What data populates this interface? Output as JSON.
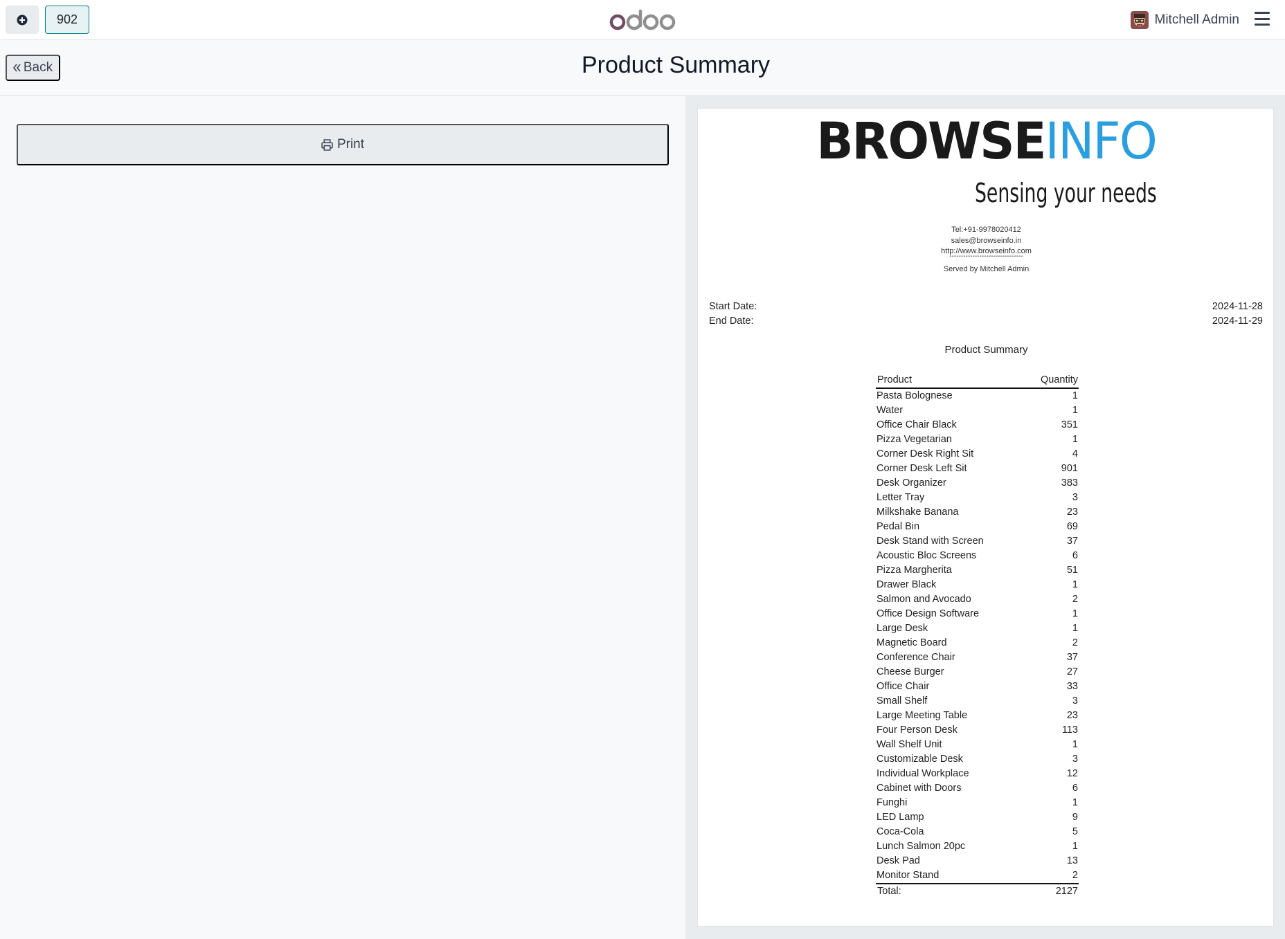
{
  "navbar": {
    "order_number": "902",
    "logo_text": "odoo",
    "user_name": "Mitchell Admin"
  },
  "header": {
    "back_label": "Back",
    "title": "Product Summary"
  },
  "left": {
    "print_label": "Print"
  },
  "receipt": {
    "brand_dark": "BROWSE",
    "brand_blue": "INFO",
    "tagline": "Sensing your needs",
    "tel": "Tel:+91-9978020412",
    "email": "sales@browseinfo.in",
    "website": "http://www.browseinfo.com",
    "dashes": "--------------------------------",
    "served_by": "Served by Mitchell Admin",
    "start_label": "Start Date:",
    "start_value": "2024-11-28",
    "end_label": "End Date:",
    "end_value": "2024-11-29",
    "summary_title": "Product Summary",
    "col_product": "Product",
    "col_quantity": "Quantity",
    "rows": [
      {
        "product": "Pasta Bolognese",
        "qty": "1"
      },
      {
        "product": "Water",
        "qty": "1"
      },
      {
        "product": "Office Chair Black",
        "qty": "351"
      },
      {
        "product": "Pizza Vegetarian",
        "qty": "1"
      },
      {
        "product": "Corner Desk Right Sit",
        "qty": "4"
      },
      {
        "product": "Corner Desk Left Sit",
        "qty": "901"
      },
      {
        "product": "Desk Organizer",
        "qty": "383"
      },
      {
        "product": "Letter Tray",
        "qty": "3"
      },
      {
        "product": "Milkshake Banana",
        "qty": "23"
      },
      {
        "product": "Pedal Bin",
        "qty": "69"
      },
      {
        "product": "Desk Stand with Screen",
        "qty": "37"
      },
      {
        "product": "Acoustic Bloc Screens",
        "qty": "6"
      },
      {
        "product": "Pizza Margherita",
        "qty": "51"
      },
      {
        "product": "Drawer Black",
        "qty": "1"
      },
      {
        "product": "Salmon and Avocado",
        "qty": "2"
      },
      {
        "product": "Office Design Software",
        "qty": "1"
      },
      {
        "product": "Large Desk",
        "qty": "1"
      },
      {
        "product": "Magnetic Board",
        "qty": "2"
      },
      {
        "product": "Conference Chair",
        "qty": "37"
      },
      {
        "product": "Cheese Burger",
        "qty": "27"
      },
      {
        "product": "Office Chair",
        "qty": "33"
      },
      {
        "product": "Small Shelf",
        "qty": "3"
      },
      {
        "product": "Large Meeting Table",
        "qty": "23"
      },
      {
        "product": "Four Person Desk",
        "qty": "113"
      },
      {
        "product": "Wall Shelf Unit",
        "qty": "1"
      },
      {
        "product": "Customizable Desk",
        "qty": "3"
      },
      {
        "product": "Individual Workplace",
        "qty": "12"
      },
      {
        "product": "Cabinet with Doors",
        "qty": "6"
      },
      {
        "product": "Funghi",
        "qty": "1"
      },
      {
        "product": "LED Lamp",
        "qty": "9"
      },
      {
        "product": "Coca-Cola",
        "qty": "5"
      },
      {
        "product": "Lunch Salmon 20pc",
        "qty": "1"
      },
      {
        "product": "Desk Pad",
        "qty": "13"
      },
      {
        "product": "Monitor Stand",
        "qty": "2"
      }
    ],
    "total_label": "Total:",
    "total_value": "2127"
  },
  "colors": {
    "odoo_purple": "#714b67",
    "odoo_grey": "#8f8f8f",
    "brand_blue": "#2a9fe0",
    "teal_border": "#017e84"
  }
}
